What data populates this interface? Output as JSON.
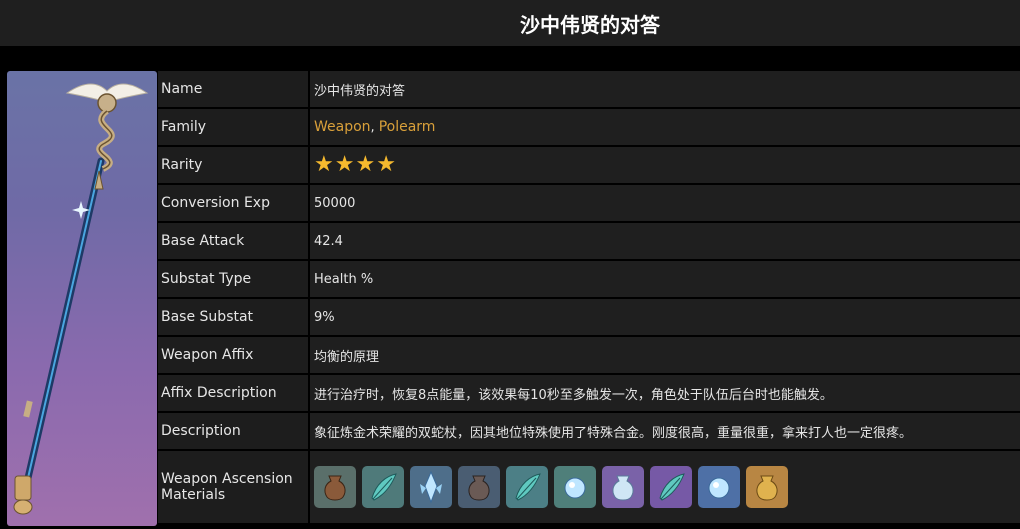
{
  "title": "沙中伟贤的对答",
  "rows": {
    "name": {
      "label": "Name",
      "value": "沙中伟贤的对答"
    },
    "family": {
      "label": "Family",
      "link1": "Weapon",
      "sep": ",",
      "link2": "Polearm"
    },
    "rarity": {
      "label": "Rarity",
      "stars": 4
    },
    "conversion": {
      "label": "Conversion Exp",
      "value": "50000"
    },
    "base_attack": {
      "label": "Base Attack",
      "value": "42.4"
    },
    "substat_type": {
      "label": "Substat Type",
      "value": "Health %"
    },
    "base_substat": {
      "label": "Base Substat",
      "value": "9%"
    },
    "affix": {
      "label": "Weapon Affix",
      "value": "均衡的原理"
    },
    "affix_desc": {
      "label": "Affix Description",
      "value": "进行治疗时，恢复8点能量，该效果每10秒至多触发一次，角色处于队伍后台时也能触发。"
    },
    "description": {
      "label": "Description",
      "value": "象征炼金术荣耀的双蛇杖，因其地位特殊使用了特殊合金。刚度很高，重量很重，拿来打人也一定很疼。"
    },
    "materials": {
      "label_line1": "Weapon Ascension",
      "label_line2": "Materials"
    }
  },
  "colors": {
    "link": "#d9a03a",
    "star": "#f5b92e"
  },
  "materials": [
    {
      "icon": "bronze-vessel-icon",
      "bg": "#5a6f6a"
    },
    {
      "icon": "teal-feather-icon",
      "bg": "#4f7a7a"
    },
    {
      "icon": "crystal-shard-icon",
      "bg": "#4e6e8a"
    },
    {
      "icon": "dark-vessel-icon",
      "bg": "#4a5d72"
    },
    {
      "icon": "teal-feather-icon",
      "bg": "#4c7f86"
    },
    {
      "icon": "crystal-orb-icon",
      "bg": "#4f7f7a"
    },
    {
      "icon": "glass-vessel-icon",
      "bg": "#7a62a8"
    },
    {
      "icon": "teal-feather-icon",
      "bg": "#7659a6"
    },
    {
      "icon": "crystal-orb-icon",
      "bg": "#4e70a6"
    },
    {
      "icon": "gold-vessel-icon",
      "bg": "#b88643"
    }
  ]
}
